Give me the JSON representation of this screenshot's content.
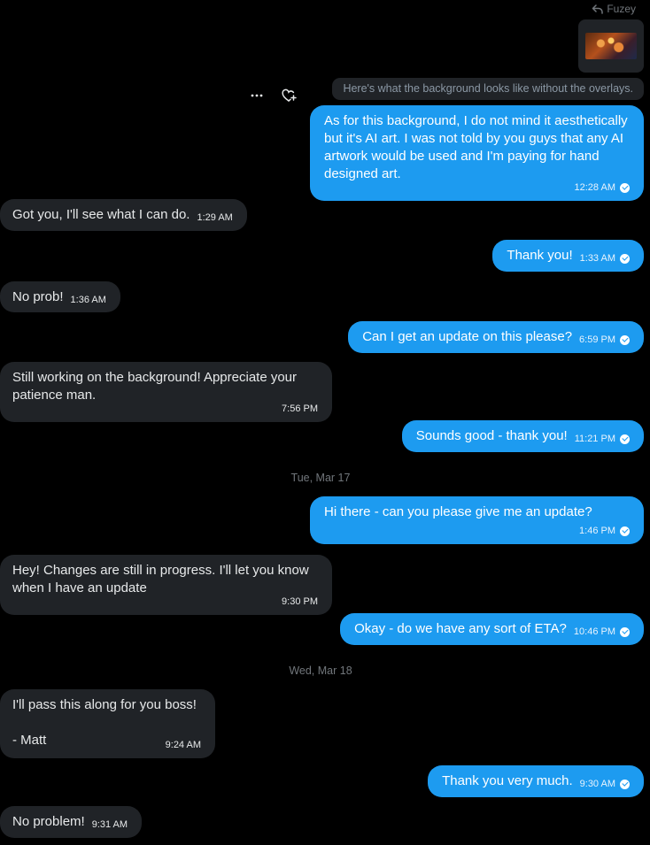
{
  "reply_context": {
    "label": "Fuzey",
    "quote": "Here's what the background looks like without the overlays."
  },
  "actions": {
    "more_icon": "more-horizontal-icon",
    "react_icon": "heart-plus-icon"
  },
  "messages": [
    {
      "dir": "out",
      "text": "As for this background, I do not mind it aesthetically but it's AI art. I was not told by you guys that any AI artwork would be used and I'm paying for hand designed art.",
      "time": "12:28 AM"
    },
    {
      "dir": "in",
      "text": "Got you, I'll see what I can do.",
      "time": "1:29 AM"
    },
    {
      "dir": "out",
      "text": "Thank you!",
      "time": "1:33 AM"
    },
    {
      "dir": "in",
      "text": "No prob!",
      "time": "1:36 AM"
    },
    {
      "dir": "out",
      "text": "Can I get an update on this please?",
      "time": "6:59 PM"
    },
    {
      "dir": "in",
      "text": "Still working on the background! Appreciate your patience man.",
      "time": "7:56 PM"
    },
    {
      "dir": "out",
      "text": "Sounds good - thank you!",
      "time": "11:21 PM"
    },
    {
      "dir": "out",
      "text": "Hi there - can you please give me an update?",
      "time": "1:46 PM"
    },
    {
      "dir": "in",
      "text": "Hey! Changes are still in progress. I'll let you know when I have an update",
      "time": "9:30 PM"
    },
    {
      "dir": "out",
      "text": "Okay - do we have any sort of ETA?",
      "time": "10:46 PM"
    },
    {
      "dir": "in",
      "text": "I'll pass this along for you boss!\n\n- Matt",
      "time": "9:24 AM"
    },
    {
      "dir": "out",
      "text": "Thank you very much.",
      "time": "9:30 AM"
    },
    {
      "dir": "in",
      "text": "No problem!",
      "time": "9:31 AM"
    }
  ],
  "date_separators": [
    "Tue, Mar 17",
    "Wed, Mar 18"
  ]
}
